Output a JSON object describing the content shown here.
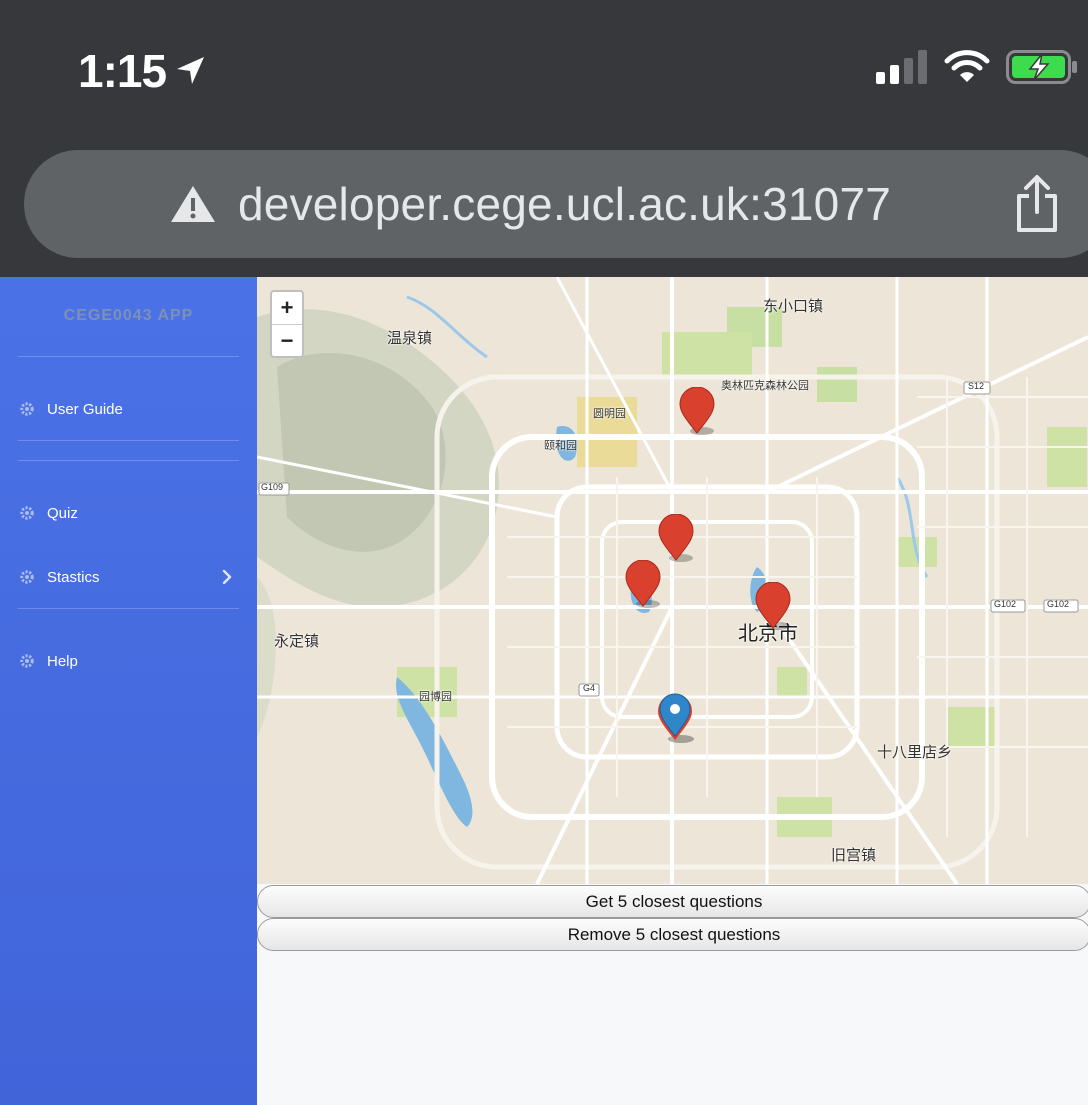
{
  "status_bar": {
    "time": "1:15",
    "location_icon": "location-arrow-icon",
    "signal_icon": "cellular-signal-icon",
    "wifi_icon": "wifi-icon",
    "battery_icon": "battery-charging-icon"
  },
  "browser": {
    "url": "developer.cege.ucl.ac.uk:31077",
    "warning_icon": "warning-icon",
    "share_icon": "share-icon"
  },
  "sidebar": {
    "brand": "CEGE0043 APP",
    "items": [
      {
        "label": "User Guide",
        "icon": "gear-icon"
      },
      {
        "label": "Quiz",
        "icon": "gear-icon"
      },
      {
        "label": "Stastics",
        "icon": "gear-icon",
        "has_submenu": true
      },
      {
        "label": "Help",
        "icon": "gear-icon"
      }
    ]
  },
  "map": {
    "zoom_in": "+",
    "zoom_out": "−",
    "places": [
      "东小口镇",
      "温泉镇",
      "奥林匹克森林公园",
      "颐和园",
      "圆明园",
      "北京市",
      "永定镇",
      "园博园",
      "十八里店乡",
      "旧宫镇",
      "G109",
      "G4",
      "G102",
      "G102",
      "S12"
    ],
    "markers": {
      "question_count": 4,
      "user_location_count": 1,
      "question_color": "#d9402e",
      "user_color": "#2f86c9"
    }
  },
  "actions": {
    "get_label": "Get 5 closest questions",
    "remove_label": "Remove 5 closest questions"
  }
}
